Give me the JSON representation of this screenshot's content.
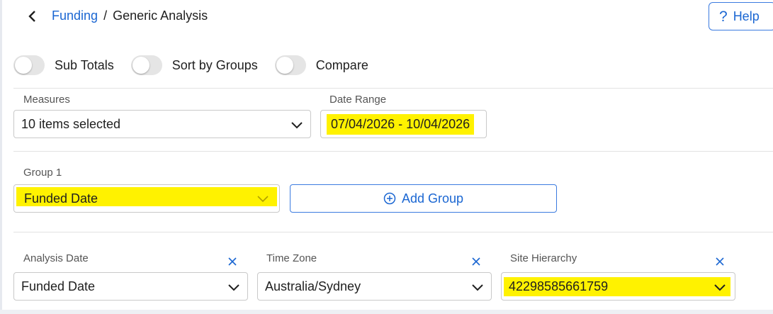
{
  "header": {
    "breadcrumb_parent": "Funding",
    "breadcrumb_separator": "/",
    "breadcrumb_current": "Generic Analysis",
    "help_label": "Help"
  },
  "toggles": [
    {
      "label": "Sub Totals",
      "on": false
    },
    {
      "label": "Sort by Groups",
      "on": false
    },
    {
      "label": "Compare",
      "on": false
    }
  ],
  "measures": {
    "label": "Measures",
    "value": "10 items selected"
  },
  "date_range": {
    "label": "Date Range",
    "value": "07/04/2026 - 10/04/2026"
  },
  "group1": {
    "label": "Group 1",
    "value": "Funded Date"
  },
  "add_group": {
    "label": "Add Group"
  },
  "analysis_date": {
    "label": "Analysis Date",
    "value": "Funded Date"
  },
  "time_zone": {
    "label": "Time Zone",
    "value": "Australia/Sydney"
  },
  "site_hierarchy": {
    "label": "Site Hierarchy",
    "value": "42298585661759"
  },
  "colors": {
    "link": "#1a66d2",
    "highlight": "#fff200",
    "border": "#c9c9c9"
  }
}
